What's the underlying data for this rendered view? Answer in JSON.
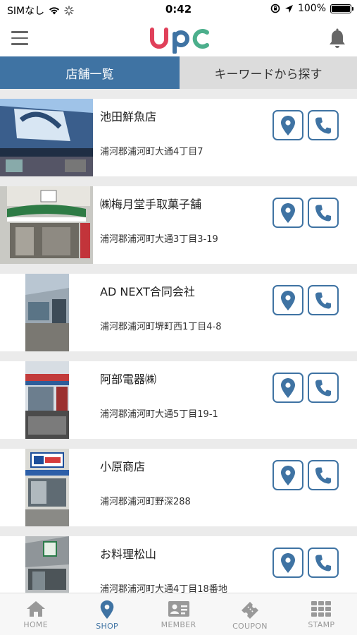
{
  "status_bar": {
    "carrier": "SIMなし",
    "time": "0:42",
    "battery_percent": "100%",
    "battery_level": 1.0
  },
  "header": {
    "logo_text": "upc",
    "logo_colors": [
      "#e0405a",
      "#3f73a3",
      "#4caf8c"
    ]
  },
  "tabs": [
    {
      "label": "店舗一覧",
      "active": true
    },
    {
      "label": "キーワードから探す",
      "active": false
    }
  ],
  "shops": [
    {
      "name": "池田鮮魚店",
      "address": "浦河郡浦河町大通4丁目7"
    },
    {
      "name": "㈱梅月堂手取菓子舗",
      "address": "浦河郡浦河町大通3丁目3-19"
    },
    {
      "name": "AD NEXT合同会社",
      "address": "浦河郡浦河町堺町西1丁目4-8"
    },
    {
      "name": "阿部電器㈱",
      "address": "浦河郡浦河町大通5丁目19-1"
    },
    {
      "name": "小原商店",
      "address": "浦河郡浦河町野深288"
    },
    {
      "name": "お料理松山",
      "address": "浦河郡浦河町大通4丁目18番地"
    }
  ],
  "bottom_nav": [
    {
      "label": "HOME",
      "icon": "home-icon",
      "active": false
    },
    {
      "label": "SHOP",
      "icon": "map-pin-icon",
      "active": true
    },
    {
      "label": "MEMBER",
      "icon": "member-card-icon",
      "active": false
    },
    {
      "label": "COUPON",
      "icon": "coupon-icon",
      "active": false
    },
    {
      "label": "STAMP",
      "icon": "stamp-grid-icon",
      "active": false
    }
  ],
  "colors": {
    "accent": "#3f73a3",
    "inactive_tab": "#dcdcdc",
    "nav_inactive": "#999999"
  }
}
